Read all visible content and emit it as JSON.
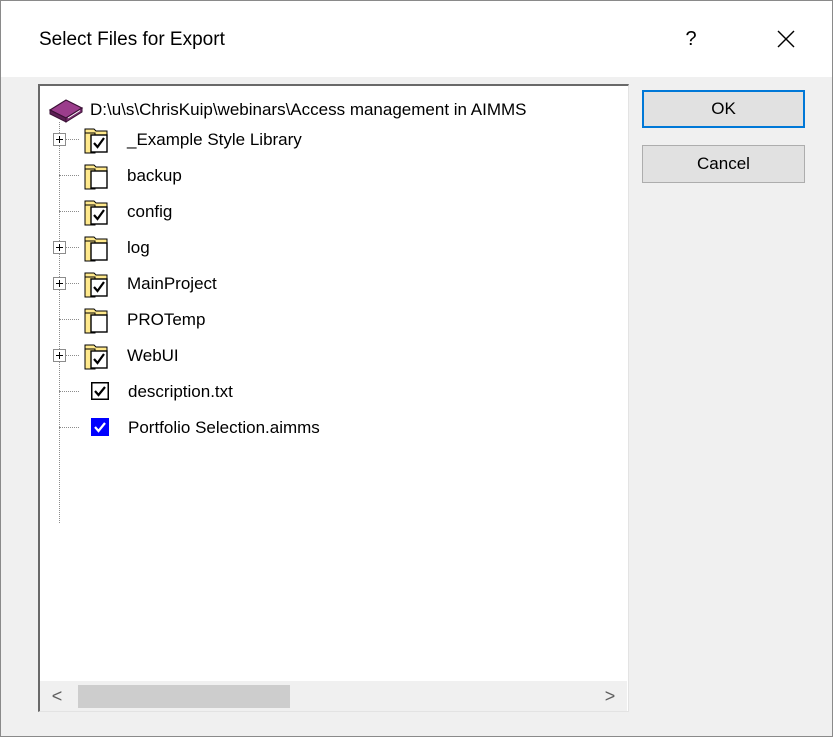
{
  "dialog": {
    "title": "Select Files for Export",
    "help_label": "?",
    "close_icon": "close-x-icon"
  },
  "tree": {
    "root": {
      "label": "D:\\u\\s\\ChrisKuip\\webinars\\Access management in AIMMS",
      "icon": "aimms-project-book-icon"
    },
    "items": [
      {
        "label": "_Example Style Library",
        "type": "folder",
        "checked": true,
        "expandable": true
      },
      {
        "label": "backup",
        "type": "folder",
        "checked": false,
        "expandable": false
      },
      {
        "label": "config",
        "type": "folder",
        "checked": true,
        "expandable": false
      },
      {
        "label": "log",
        "type": "folder",
        "checked": false,
        "expandable": true
      },
      {
        "label": "MainProject",
        "type": "folder",
        "checked": true,
        "expandable": true
      },
      {
        "label": "PROTemp",
        "type": "folder",
        "checked": false,
        "expandable": false
      },
      {
        "label": "WebUI",
        "type": "folder",
        "checked": true,
        "expandable": true
      },
      {
        "label": "description.txt",
        "type": "file",
        "checked": true,
        "expandable": false
      },
      {
        "label": "Portfolio Selection.aimms",
        "type": "file",
        "checked": true,
        "expandable": false,
        "focused": true
      }
    ]
  },
  "scrollbar": {
    "left_arrow": "<",
    "right_arrow": ">",
    "position_fraction": 0.0
  },
  "buttons": {
    "ok_label": "OK",
    "cancel_label": "Cancel"
  },
  "colors": {
    "folder_yellow": "#ffe98c",
    "focus_blue": "#0000ff",
    "default_button_border": "#0078d7",
    "root_icon_purple": "#7a2e6e"
  }
}
